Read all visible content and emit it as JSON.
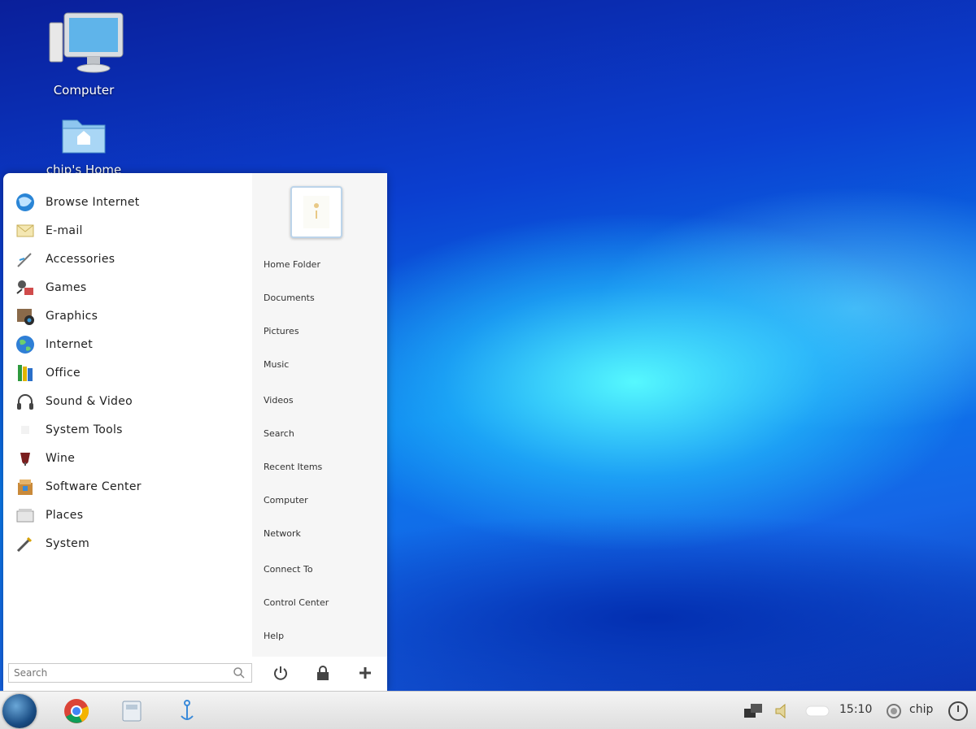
{
  "desktop": {
    "icons": [
      {
        "label": "Computer",
        "icon": "monitor-icon"
      },
      {
        "label": "chip's Home",
        "icon": "home-folder-icon"
      }
    ]
  },
  "start_menu": {
    "categories": [
      {
        "label": "Browse Internet",
        "icon": "web-browser-icon"
      },
      {
        "label": "E-mail",
        "icon": "email-icon"
      },
      {
        "label": "Accessories",
        "icon": "accessories-icon"
      },
      {
        "label": "Games",
        "icon": "games-icon"
      },
      {
        "label": "Graphics",
        "icon": "graphics-icon"
      },
      {
        "label": "Internet",
        "icon": "internet-globe-icon"
      },
      {
        "label": "Office",
        "icon": "office-icon"
      },
      {
        "label": "Sound & Video",
        "icon": "headphones-icon"
      },
      {
        "label": "System Tools",
        "icon": "system-tools-icon"
      },
      {
        "label": "Wine",
        "icon": "wine-icon"
      },
      {
        "label": "Software Center",
        "icon": "software-center-icon"
      },
      {
        "label": "Places",
        "icon": "places-icon"
      },
      {
        "label": "System",
        "icon": "system-icon"
      }
    ],
    "places": [
      "Home Folder",
      "Documents",
      "Pictures",
      "Music",
      "Videos",
      "Search",
      "Recent Items",
      "Computer",
      "Network",
      "Connect To",
      "Control Center",
      "Help"
    ],
    "search_placeholder": "Search",
    "actions": [
      {
        "icon": "power-icon"
      },
      {
        "icon": "lock-icon"
      },
      {
        "icon": "add-icon"
      }
    ]
  },
  "taskbar": {
    "launchers": [
      {
        "icon": "chrome-icon"
      },
      {
        "icon": "file-manager-icon"
      },
      {
        "icon": "anchor-icon"
      }
    ],
    "clock": "15:10",
    "user": "chip"
  }
}
